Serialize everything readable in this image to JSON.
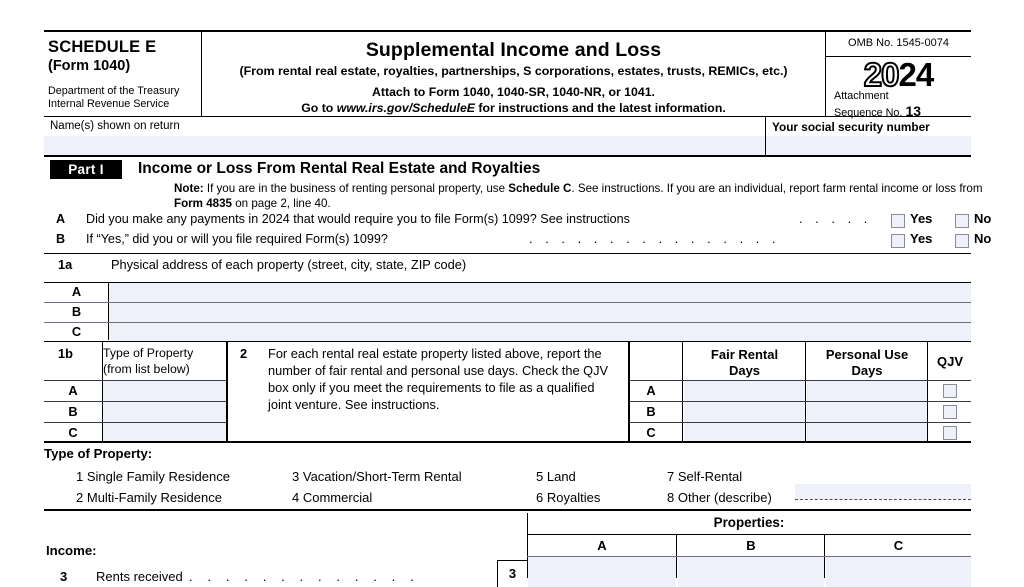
{
  "header": {
    "schedule_name": "SCHEDULE E",
    "form_ref": "(Form 1040)",
    "dept_line1": "Department of the Treasury",
    "dept_line2": "Internal Revenue Service",
    "title": "Supplemental Income and Loss",
    "subtitle": "(From rental real estate, royalties, partnerships, S corporations, estates, trusts, REMICs, etc.)",
    "attach_line": "Attach to Form 1040, 1040-SR, 1040-NR, or 1041.",
    "goto_prefix": "Go to ",
    "goto_url": "www.irs.gov/ScheduleE",
    "goto_suffix": " for instructions and the latest information.",
    "omb": "OMB No. 1545-0074",
    "year_hollow": "20",
    "year_solid": "24",
    "attachment_label_1": "Attachment",
    "attachment_label_2": "Sequence No.",
    "sequence_no": "13"
  },
  "name_row": {
    "name_label": "Name(s) shown on return",
    "name_value": "",
    "ssn_label": "Your social security number",
    "ssn_value": ""
  },
  "part1": {
    "badge": "Part I",
    "title": "Income or Loss From Rental Real Estate and Royalties",
    "note_bold": "Note:",
    "note_text_1": " If you are in the business of renting personal property, use ",
    "note_bold_2": "Schedule C",
    "note_text_2": ". See instructions. If you are an individual, report farm rental income or loss from ",
    "note_bold_3": "Form 4835",
    "note_text_3": " on page 2, line 40."
  },
  "questions": [
    {
      "letter": "A",
      "text": "Did you make any payments in 2024 that would require you to file Form(s) 1099? See instructions",
      "leader": ". . . . .",
      "yes_label": "Yes",
      "no_label": "No",
      "yes_checked": false,
      "no_checked": false
    },
    {
      "letter": "B",
      "text": "If “Yes,” did you or will you file required Form(s) 1099?",
      "leader": ". . . . . . . . . . . . . . . .",
      "yes_label": "Yes",
      "no_label": "No",
      "yes_checked": false,
      "no_checked": false
    }
  ],
  "line_1a": {
    "number": "1a",
    "label": "Physical address of each property (street, city, state, ZIP code)",
    "rows": [
      {
        "letter": "A",
        "value": ""
      },
      {
        "letter": "B",
        "value": ""
      },
      {
        "letter": "C",
        "value": ""
      }
    ]
  },
  "line_1b": {
    "number": "1b",
    "col_header_1": "Type of Property",
    "col_header_2": "(from list below)",
    "rows": [
      {
        "letter": "A",
        "value": ""
      },
      {
        "letter": "B",
        "value": ""
      },
      {
        "letter": "C",
        "value": ""
      }
    ],
    "line2_number": "2",
    "line2_text": "For each rental real estate property listed above, report the number of fair rental and personal use days. Check the QJV box only if you meet the requirements to file as a qualified joint venture. See instructions.",
    "days_headers": {
      "fair_rental": "Fair Rental\nDays",
      "fair_rental_l1": "Fair Rental",
      "fair_rental_l2": "Days",
      "personal_use_l1": "Personal Use",
      "personal_use_l2": "Days",
      "qjv": "QJV"
    },
    "days_rows": [
      {
        "letter": "A",
        "fair_rental_days": "",
        "personal_use_days": "",
        "qjv_checked": false
      },
      {
        "letter": "B",
        "fair_rental_days": "",
        "personal_use_days": "",
        "qjv_checked": false
      },
      {
        "letter": "C",
        "fair_rental_days": "",
        "personal_use_days": "",
        "qjv_checked": false
      }
    ]
  },
  "type_of_property": {
    "heading": "Type of Property:",
    "items": [
      {
        "number": "1",
        "label": "Single Family Residence"
      },
      {
        "number": "2",
        "label": "Multi-Family Residence"
      },
      {
        "number": "3",
        "label": "Vacation/Short-Term Rental"
      },
      {
        "number": "4",
        "label": "Commercial"
      },
      {
        "number": "5",
        "label": "Land"
      },
      {
        "number": "6",
        "label": "Royalties"
      },
      {
        "number": "7",
        "label": "Self-Rental"
      },
      {
        "number": "8",
        "label": "Other (describe)"
      }
    ],
    "other_value": ""
  },
  "properties_section": {
    "properties_title": "Properties:",
    "columns": [
      "A",
      "B",
      "C"
    ],
    "income_label": "Income:",
    "line3": {
      "number": "3",
      "label": "Rents received",
      "leader": ". . . . . . . . . . . . .",
      "box_number": "3",
      "values": [
        "",
        "",
        ""
      ]
    }
  },
  "colors": {
    "field_fill": "#eef1fa",
    "rule": "#000000",
    "checkbox_border": "#8b8b99"
  }
}
